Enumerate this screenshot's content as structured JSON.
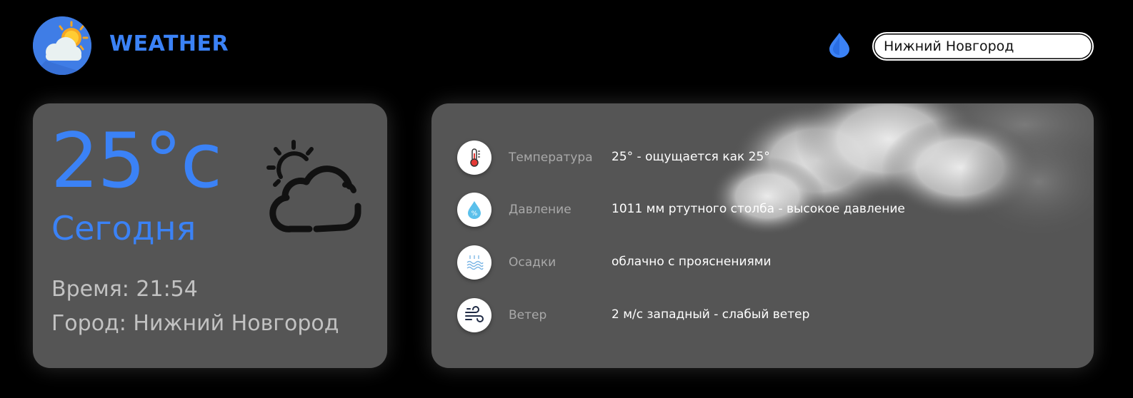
{
  "header": {
    "brand": "WEATHER",
    "search_value": "Нижний Новгород",
    "accent_color": "#3b82f6"
  },
  "current": {
    "temperature": "25°c",
    "day": "Сегодня",
    "time_line": "Время: 21:54",
    "city_line": "Город: Нижний Новгород",
    "icon": "partly-cloudy-icon"
  },
  "details": [
    {
      "icon": "thermometer-icon",
      "label": "Температура",
      "value": "25° - ощущается как 25°"
    },
    {
      "icon": "pressure-drop-icon",
      "label": "Давление",
      "value": "1011 мм ртутного столба - высокое давление"
    },
    {
      "icon": "precipitation-icon",
      "label": "Осадки",
      "value": "облачно с прояснениями"
    },
    {
      "icon": "wind-icon",
      "label": "Ветер",
      "value": "2 м/с западный - слабый ветер"
    }
  ],
  "colors": {
    "background": "#000000",
    "card": "#555555",
    "accent": "#3b82f6",
    "muted_text": "#c2c2c2"
  }
}
